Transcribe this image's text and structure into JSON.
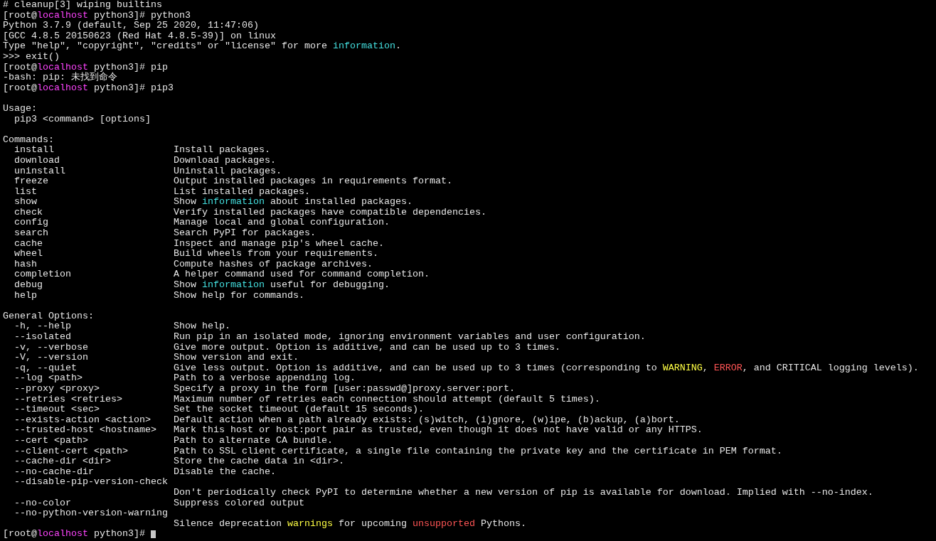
{
  "lines": [
    {
      "kind": "text",
      "segments": [
        {
          "text": "# cleanup[3] wiping builtins"
        }
      ]
    },
    {
      "kind": "text",
      "segments": [
        {
          "text": "[root@"
        },
        {
          "text": "localhost",
          "color": "#ff44ff"
        },
        {
          "text": " python3]# python3"
        }
      ]
    },
    {
      "kind": "text",
      "segments": [
        {
          "text": "Python 3.7.9 (default, Sep 25 2020, 11:47:06)"
        }
      ]
    },
    {
      "kind": "text",
      "segments": [
        {
          "text": "[GCC 4.8.5 20150623 (Red Hat 4.8.5-39)] on linux"
        }
      ]
    },
    {
      "kind": "text",
      "segments": [
        {
          "text": "Type \"help\", \"copyright\", \"credits\" or \"license\" for more "
        },
        {
          "text": "information",
          "color": "#44e0e0"
        },
        {
          "text": "."
        }
      ]
    },
    {
      "kind": "text",
      "segments": [
        {
          "text": ">>> exit()"
        }
      ]
    },
    {
      "kind": "text",
      "segments": [
        {
          "text": "[root@"
        },
        {
          "text": "localhost",
          "color": "#ff44ff"
        },
        {
          "text": " python3]# pip"
        }
      ]
    },
    {
      "kind": "text",
      "segments": [
        {
          "text": "-bash: pip: 未找到命令"
        }
      ]
    },
    {
      "kind": "text",
      "segments": [
        {
          "text": "[root@"
        },
        {
          "text": "localhost",
          "color": "#ff44ff"
        },
        {
          "text": " python3]# pip3"
        }
      ]
    },
    {
      "kind": "blank"
    },
    {
      "kind": "text",
      "segments": [
        {
          "text": "Usage:"
        }
      ]
    },
    {
      "kind": "text",
      "segments": [
        {
          "text": "  pip3 <command> [options]"
        }
      ]
    },
    {
      "kind": "blank"
    },
    {
      "kind": "text",
      "segments": [
        {
          "text": "Commands:"
        }
      ]
    },
    {
      "kind": "entry",
      "term": "install",
      "desc": [
        {
          "text": "Install packages."
        }
      ]
    },
    {
      "kind": "entry",
      "term": "download",
      "desc": [
        {
          "text": "Download packages."
        }
      ]
    },
    {
      "kind": "entry",
      "term": "uninstall",
      "desc": [
        {
          "text": "Uninstall packages."
        }
      ]
    },
    {
      "kind": "entry",
      "term": "freeze",
      "desc": [
        {
          "text": "Output installed packages in requirements format."
        }
      ]
    },
    {
      "kind": "entry",
      "term": "list",
      "desc": [
        {
          "text": "List installed packages."
        }
      ]
    },
    {
      "kind": "entry",
      "term": "show",
      "desc": [
        {
          "text": "Show "
        },
        {
          "text": "information",
          "color": "#44e0e0"
        },
        {
          "text": " about installed packages."
        }
      ]
    },
    {
      "kind": "entry",
      "term": "check",
      "desc": [
        {
          "text": "Verify installed packages have compatible dependencies."
        }
      ]
    },
    {
      "kind": "entry",
      "term": "config",
      "desc": [
        {
          "text": "Manage local and global configuration."
        }
      ]
    },
    {
      "kind": "entry",
      "term": "search",
      "desc": [
        {
          "text": "Search PyPI for packages."
        }
      ]
    },
    {
      "kind": "entry",
      "term": "cache",
      "desc": [
        {
          "text": "Inspect and manage pip's wheel cache."
        }
      ]
    },
    {
      "kind": "entry",
      "term": "wheel",
      "desc": [
        {
          "text": "Build wheels from your requirements."
        }
      ]
    },
    {
      "kind": "entry",
      "term": "hash",
      "desc": [
        {
          "text": "Compute hashes of package archives."
        }
      ]
    },
    {
      "kind": "entry",
      "term": "completion",
      "desc": [
        {
          "text": "A helper command used for command completion."
        }
      ]
    },
    {
      "kind": "entry",
      "term": "debug",
      "desc": [
        {
          "text": "Show "
        },
        {
          "text": "information",
          "color": "#44e0e0"
        },
        {
          "text": " useful for debugging."
        }
      ]
    },
    {
      "kind": "entry",
      "term": "help",
      "desc": [
        {
          "text": "Show help for commands."
        }
      ]
    },
    {
      "kind": "blank"
    },
    {
      "kind": "text",
      "segments": [
        {
          "text": "General Options:"
        }
      ]
    },
    {
      "kind": "entry",
      "term": "-h, --help",
      "desc": [
        {
          "text": "Show help."
        }
      ]
    },
    {
      "kind": "entry",
      "term": "--isolated",
      "desc": [
        {
          "text": "Run pip in an isolated mode, ignoring environment variables and user configuration."
        }
      ]
    },
    {
      "kind": "entry",
      "term": "-v, --verbose",
      "desc": [
        {
          "text": "Give more output. Option is additive, and can be used up to 3 times."
        }
      ]
    },
    {
      "kind": "entry",
      "term": "-V, --version",
      "desc": [
        {
          "text": "Show version and exit."
        }
      ]
    },
    {
      "kind": "entry",
      "term": "-q, --quiet",
      "desc": [
        {
          "text": "Give less output. Option is additive, and can be used up to 3 times (corresponding to "
        },
        {
          "text": "WARNING",
          "color": "#ffff44"
        },
        {
          "text": ", "
        },
        {
          "text": "ERROR",
          "color": "#ff5555"
        },
        {
          "text": ", and CRITICAL logging levels)."
        }
      ]
    },
    {
      "kind": "entry",
      "term": "--log <path>",
      "desc": [
        {
          "text": "Path to a verbose appending log."
        }
      ]
    },
    {
      "kind": "entry",
      "term": "--proxy <proxy>",
      "desc": [
        {
          "text": "Specify a proxy in the form [user:passwd@]proxy.server:port."
        }
      ]
    },
    {
      "kind": "entry",
      "term": "--retries <retries>",
      "desc": [
        {
          "text": "Maximum number of retries each connection should attempt (default 5 times)."
        }
      ]
    },
    {
      "kind": "entry",
      "term": "--timeout <sec>",
      "desc": [
        {
          "text": "Set the socket timeout (default 15 seconds)."
        }
      ]
    },
    {
      "kind": "entry",
      "term": "--exists-action <action>",
      "desc": [
        {
          "text": "Default action when a path already exists: (s)witch, (i)gnore, (w)ipe, (b)ackup, (a)bort."
        }
      ]
    },
    {
      "kind": "entry",
      "term": "--trusted-host <hostname>",
      "desc": [
        {
          "text": "Mark this host or host:port pair as trusted, even though it does not have valid or any HTTPS."
        }
      ]
    },
    {
      "kind": "entry",
      "term": "--cert <path>",
      "desc": [
        {
          "text": "Path to alternate CA bundle."
        }
      ]
    },
    {
      "kind": "entry",
      "term": "--client-cert <path>",
      "desc": [
        {
          "text": "Path to SSL client certificate, a single file containing the private key and the certificate in PEM format."
        }
      ]
    },
    {
      "kind": "entry",
      "term": "--cache-dir <dir>",
      "desc": [
        {
          "text": "Store the cache data in <dir>."
        }
      ]
    },
    {
      "kind": "entry",
      "term": "--no-cache-dir",
      "desc": [
        {
          "text": "Disable the cache."
        }
      ]
    },
    {
      "kind": "entry",
      "term": "--disable-pip-version-check"
    },
    {
      "kind": "entry",
      "desc": [
        {
          "text": "Don't periodically check PyPI to determine whether a new version of pip is available for download. Implied with --no-index."
        }
      ]
    },
    {
      "kind": "entry",
      "term": "--no-color",
      "desc": [
        {
          "text": "Suppress colored output"
        }
      ]
    },
    {
      "kind": "entry",
      "term": "--no-python-version-warning"
    },
    {
      "kind": "entry",
      "desc": [
        {
          "text": "Silence deprecation "
        },
        {
          "text": "warnings",
          "color": "#ffff44"
        },
        {
          "text": " for upcoming "
        },
        {
          "text": "unsupported",
          "color": "#ff5555"
        },
        {
          "text": " Pythons."
        }
      ]
    },
    {
      "kind": "text",
      "cursor": true,
      "segments": [
        {
          "text": "[root@"
        },
        {
          "text": "localhost",
          "color": "#ff44ff"
        },
        {
          "text": " python3]# "
        }
      ]
    }
  ]
}
